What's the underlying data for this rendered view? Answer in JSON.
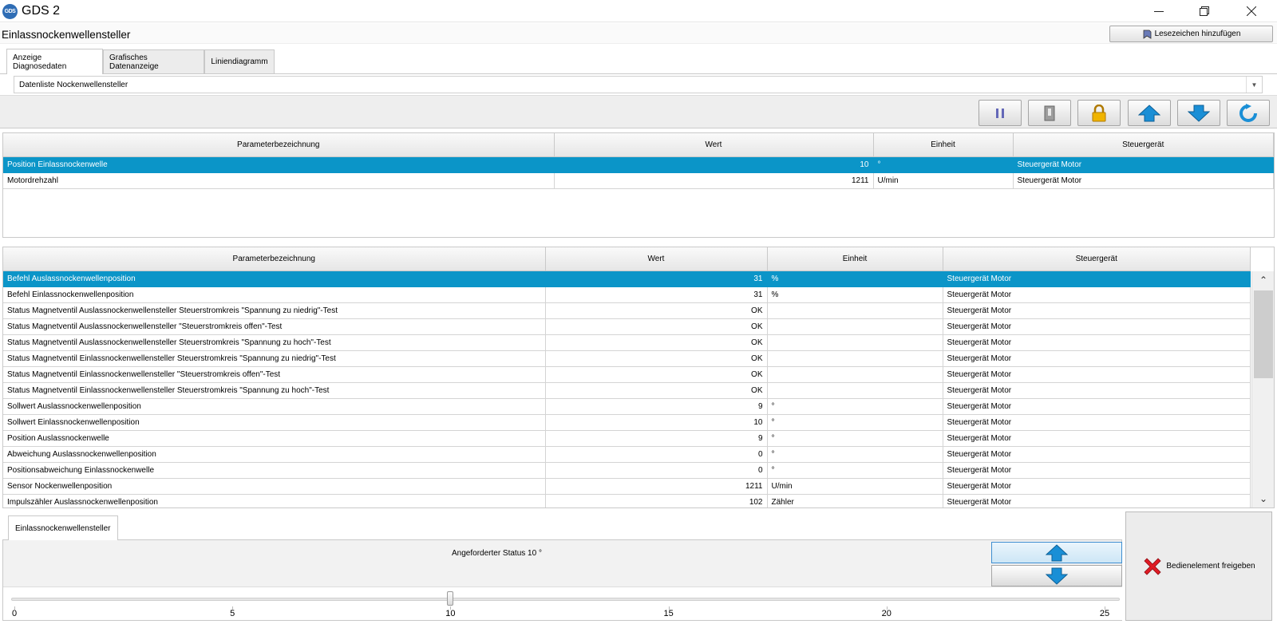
{
  "window": {
    "logo_text": "GDS",
    "title": "GDS 2"
  },
  "header": {
    "page_title": "Einlassnockenwellensteller",
    "bookmark_label": "Lesezeichen hinzufügen"
  },
  "tabs": [
    {
      "label": "Anzeige Diagnosedaten",
      "active": true
    },
    {
      "label": "Grafisches Datenanzeige",
      "active": false
    },
    {
      "label": "Liniendiagramm",
      "active": false
    }
  ],
  "datalist": {
    "selected": "Datenliste Nockenwellensteller"
  },
  "toolbar": {
    "buttons": [
      "pause-icon",
      "clipboard-icon",
      "lock-icon",
      "arrow-up-icon",
      "arrow-down-icon",
      "refresh-icon"
    ]
  },
  "table_headers": {
    "param": "Parameterbezeichnung",
    "value": "Wert",
    "unit": "Einheit",
    "ecu": "Steuergerät"
  },
  "selected_params": [
    {
      "param": "Position Einlassnockenwelle",
      "value": "10",
      "unit": "°",
      "ecu": "Steuergerät Motor",
      "selected": true
    },
    {
      "param": "Motordrehzahl",
      "value": "1211",
      "unit": "U/min",
      "ecu": "Steuergerät Motor",
      "selected": false
    }
  ],
  "all_params": [
    {
      "param": "Befehl Auslassnockenwellenposition",
      "value": "31",
      "unit": "%",
      "ecu": "Steuergerät Motor",
      "selected": true
    },
    {
      "param": "Befehl Einlassnockenwellenposition",
      "value": "31",
      "unit": "%",
      "ecu": "Steuergerät Motor"
    },
    {
      "param": "Status Magnetventil Auslassnockenwellensteller Steuerstromkreis \"Spannung zu niedrig\"-Test",
      "value": "OK",
      "unit": "",
      "ecu": "Steuergerät Motor"
    },
    {
      "param": "Status Magnetventil Auslassnockenwellensteller \"Steuerstromkreis offen\"-Test",
      "value": "OK",
      "unit": "",
      "ecu": "Steuergerät Motor"
    },
    {
      "param": "Status Magnetventil Auslassnockenwellensteller Steuerstromkreis \"Spannung zu hoch\"-Test",
      "value": "OK",
      "unit": "",
      "ecu": "Steuergerät Motor"
    },
    {
      "param": "Status Magnetventil Einlassnockenwellensteller Steuerstromkreis \"Spannung zu niedrig\"-Test",
      "value": "OK",
      "unit": "",
      "ecu": "Steuergerät Motor"
    },
    {
      "param": "Status Magnetventil Einlassnockenwellensteller \"Steuerstromkreis offen\"-Test",
      "value": "OK",
      "unit": "",
      "ecu": "Steuergerät Motor"
    },
    {
      "param": "Status Magnetventil Einlassnockenwellensteller Steuerstromkreis \"Spannung zu hoch\"-Test",
      "value": "OK",
      "unit": "",
      "ecu": "Steuergerät Motor"
    },
    {
      "param": "Sollwert Auslassnockenwellenposition",
      "value": "9",
      "unit": "°",
      "ecu": "Steuergerät Motor"
    },
    {
      "param": "Sollwert Einlassnockenwellenposition",
      "value": "10",
      "unit": "°",
      "ecu": "Steuergerät Motor"
    },
    {
      "param": "Position Auslassnockenwelle",
      "value": "9",
      "unit": "°",
      "ecu": "Steuergerät Motor"
    },
    {
      "param": "Abweichung Auslassnockenwellenposition",
      "value": "0",
      "unit": "°",
      "ecu": "Steuergerät Motor"
    },
    {
      "param": "Positionsabweichung Einlassnockenwelle",
      "value": "0",
      "unit": "°",
      "ecu": "Steuergerät Motor"
    },
    {
      "param": "Sensor Nockenwellenposition",
      "value": "1211",
      "unit": "U/min",
      "ecu": "Steuergerät Motor"
    },
    {
      "param": "Impulszähler Auslassnockenwellenposition",
      "value": "102",
      "unit": "Zähler",
      "ecu": "Steuergerät Motor"
    }
  ],
  "control": {
    "tab_label": "Einlassnockenwellensteller",
    "status_text": "Angeforderter Status 10 °",
    "slider": {
      "min": 0,
      "max": 25,
      "value": 10,
      "ticks": [
        0,
        5,
        10,
        15,
        20,
        25
      ]
    },
    "release_label": "Bedienelement freigeben"
  },
  "colors": {
    "selection": "#0b95c8",
    "accent_blue": "#1a8fd6"
  }
}
